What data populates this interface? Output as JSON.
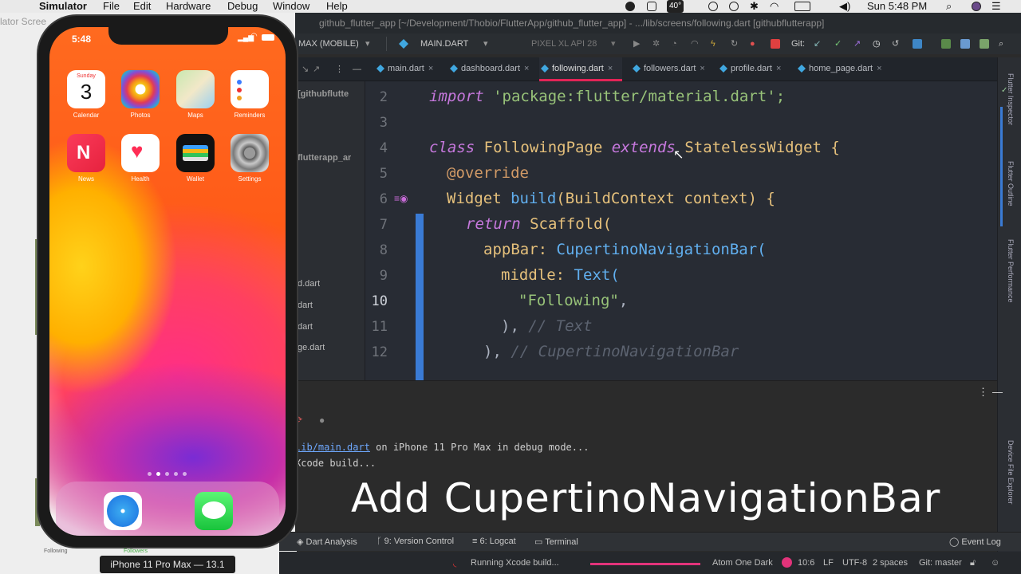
{
  "menubar": {
    "app": "Simulator",
    "items": [
      "File",
      "Edit",
      "Hardware",
      "Debug",
      "Window",
      "Help"
    ],
    "temperature": "40°",
    "clock": "Sun 5:48 PM"
  },
  "window_title": "github_flutter_app [~/Development/Thobio/FlutterApp/github_flutter_app] - .../lib/screens/following.dart [githubflutterapp]",
  "toolbar": {
    "device_selector": "MAX (MOBILE)",
    "run_config": "MAIN.DART",
    "emulator": "PIXEL XL API 28",
    "git_label": "Git:"
  },
  "tabs": [
    {
      "label": "main.dart",
      "active": false
    },
    {
      "label": "dashboard.dart",
      "active": false
    },
    {
      "label": "following.dart",
      "active": true
    },
    {
      "label": "followers.dart",
      "active": false
    },
    {
      "label": "profile.dart",
      "active": false
    },
    {
      "label": "home_page.dart",
      "active": false
    }
  ],
  "project_panel": {
    "items": [
      "[githubflutte",
      "flutterapp_ar",
      "d.dart",
      "dart",
      "dart",
      "ge.dart"
    ]
  },
  "editor": {
    "line_numbers": [
      "2",
      "3",
      "4",
      "5",
      "6",
      "7",
      "8",
      "9",
      "10",
      "11",
      "12"
    ],
    "lines": {
      "l2a": "import",
      "l2b": " 'package:flutter/material.dart';",
      "l4a": "class",
      "l4b": " FollowingPage ",
      "l4c": "extends",
      "l4d": " StatelessWidget {",
      "l5": "@override",
      "l6a": "Widget",
      "l6b": " build",
      "l6c": "(BuildContext context) {",
      "l7a": "return",
      "l7b": " Scaffold(",
      "l8a": "appBar: ",
      "l8b": "CupertinoNavigationBar(",
      "l9a": "middle: ",
      "l9b": "Text(",
      "l10a": "\"Following\"",
      "l10b": ",",
      "l11a": "), ",
      "l11b": "// Text",
      "l12a": "), ",
      "l12b": "// CupertinoNavigationBar"
    }
  },
  "run_panel": {
    "line1_link": "lib/main.dart",
    "line1_rest": " on iPhone 11 Pro Max in debug mode...",
    "line2": "Xcode build..."
  },
  "caption": "Add CupertinoNavigationBar",
  "tool_tabs": [
    "Dart Analysis",
    "9: Version Control",
    "6: Logcat",
    "Terminal",
    "Event Log"
  ],
  "statusbar": {
    "task": "Running Xcode build...",
    "theme": "Atom One Dark",
    "position": "10:6",
    "line_sep": "LF",
    "encoding": "UTF-8",
    "indent": "2 spaces",
    "git": "Git: master"
  },
  "right_strip": [
    "Flutter Inspector",
    "Flutter Outline",
    "Flutter Performance",
    "Device File Explorer"
  ],
  "simulator": {
    "window_label": "lator Scree",
    "device_label": "iPhone 11 Pro Max — 13.1",
    "phone_time": "5:48",
    "calendar_day": "Sunday",
    "calendar_date": "3",
    "apps": [
      "Calendar",
      "Photos",
      "Maps",
      "Reminders",
      "News",
      "Health",
      "Wallet",
      "Settings"
    ],
    "bg_labels": [
      "Following",
      "Followers"
    ]
  }
}
